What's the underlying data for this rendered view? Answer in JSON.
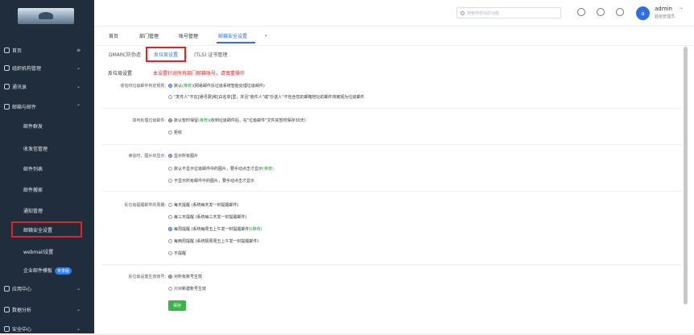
{
  "sidebar": {
    "items": [
      {
        "label": "首页",
        "icon": "home-icon"
      },
      {
        "label": "组织机构管理",
        "icon": "org-icon"
      },
      {
        "label": "通讯录",
        "icon": "contacts-icon"
      },
      {
        "label": "邮箱与邮件",
        "icon": "mail-icon"
      }
    ],
    "sub_items": [
      {
        "label": "邮件群发"
      },
      {
        "label": "收发信管理"
      },
      {
        "label": "邮件列表"
      },
      {
        "label": "邮件搬家"
      },
      {
        "label": "通知管理"
      },
      {
        "label": "邮箱安全设置"
      },
      {
        "label": "webmail设置"
      },
      {
        "label": "企业邮件模板",
        "badge": "专享版"
      }
    ],
    "bottom_items": [
      {
        "label": "应用中心",
        "icon": "apps-icon"
      },
      {
        "label": "数据分析",
        "icon": "chart-icon"
      },
      {
        "label": "安全中心",
        "icon": "shield-icon"
      }
    ]
  },
  "topbar": {
    "search_placeholder": "搜索你想找的功能",
    "user_name": "admin",
    "user_role": "超级管理员",
    "avatar_letter": "a"
  },
  "tabs": [
    {
      "label": "首页"
    },
    {
      "label": "部门管理"
    },
    {
      "label": "账号管理"
    },
    {
      "label": "邮箱安全设置"
    }
  ],
  "subtabs": [
    {
      "label": "DMARC防伪造"
    },
    {
      "label": "反垃圾设置"
    },
    {
      "label": "(TLS) 证书管理"
    }
  ],
  "section": {
    "title": "反垃圾设置",
    "warning": "本设置针对所有部门邮箱账号，请慎重操作"
  },
  "groups": [
    {
      "label": "收信时垃圾邮件判定规则:",
      "options": [
        {
          "text": "默认",
          "rec": "(推荐)",
          "rest": "(网易邮件反垃圾系统智能处理垃圾邮件)"
        },
        {
          "text": "\"发件人\"不在[通讯录]和[白名单]里，并且\"收件人\"或\"抄送人\"不包含您的邮箱地址的邮件将被视为垃圾邮件",
          "rec": "",
          "rest": ""
        }
      ]
    },
    {
      "label": "如何处理垃圾邮件:",
      "options": [
        {
          "text": "默认暂时保留",
          "rec": "(推荐)",
          "rest": "(收到垃圾邮件后，在\"垃圾邮件\"文件夹暂时保存30天)"
        },
        {
          "text": "拒收",
          "rec": "",
          "rest": ""
        }
      ]
    },
    {
      "label": "读信时，图片的显示:",
      "options": [
        {
          "text": "显示所有图片",
          "rec": "",
          "rest": ""
        },
        {
          "text": "默认不显示垃圾邮件中的图片，要手动点击才显示",
          "rec": "(推荐)",
          "rest": ""
        },
        {
          "text": "不显示所有邮件中的图片，要手动点击才显示",
          "rec": "",
          "rest": ""
        }
      ]
    },
    {
      "label": "反垃圾提醒邮件的周期:",
      "options": [
        {
          "text": "每天提醒 (系统每天发一封提醒邮件)",
          "rec": "",
          "rest": ""
        },
        {
          "text": "每三天提醒 (系统每三天发一封提醒邮件)",
          "rec": "",
          "rest": ""
        },
        {
          "text": "每周提醒 (系统每周五上午发一封提醒邮件)",
          "rec": "(推荐)",
          "rest": ""
        },
        {
          "text": "每两周提醒 (系统隔周周五上午发一封提醒邮件)",
          "rec": "",
          "rest": ""
        },
        {
          "text": "不提醒",
          "rec": "",
          "rest": ""
        }
      ]
    },
    {
      "label": "反垃圾设置生效账号:",
      "options": [
        {
          "text": "对所有账号生效",
          "rec": "",
          "rest": ""
        },
        {
          "text": "只对新建账号生效",
          "rec": "",
          "rest": ""
        }
      ]
    }
  ],
  "save_label": "保存"
}
